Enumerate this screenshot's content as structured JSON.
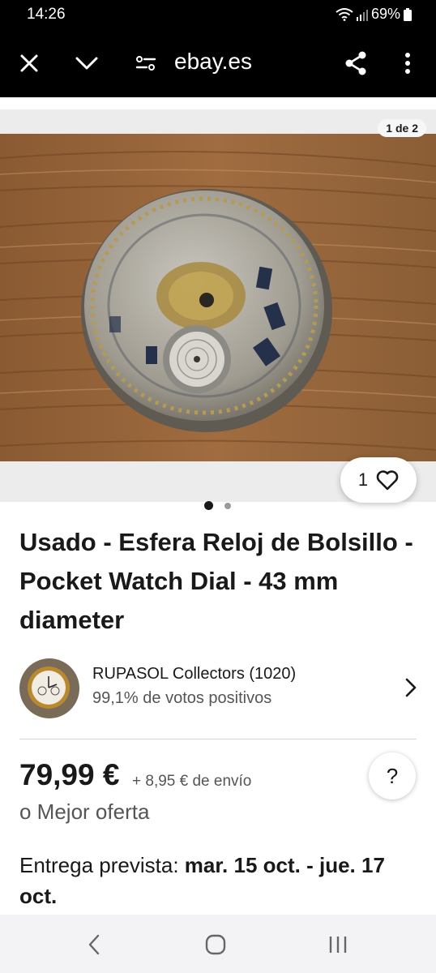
{
  "status_bar": {
    "time": "14:26",
    "battery": "69%",
    "icons": [
      "wifi-icon",
      "signal-icon",
      "battery-icon"
    ]
  },
  "toolbar": {
    "url": "ebay.es",
    "icons": [
      "close-icon",
      "chevron-down-icon",
      "tune-icon",
      "share-icon",
      "more-vert-icon"
    ]
  },
  "gallery": {
    "counter": "1 de 2",
    "watch_count": "1",
    "page_dots": 2,
    "active_dot": 0
  },
  "listing": {
    "title": "Usado - Esfera Reloj de Bolsillo - Pocket Watch Dial - 43 mm diameter",
    "price": "79,99 €",
    "shipping": "+ 8,95 € de envío",
    "best_offer": "o Mejor oferta",
    "delivery_label": "Entrega prevista:",
    "delivery_dates": "mar. 15 oct. - jue. 17 oct."
  },
  "seller": {
    "name": "RUPASOL Collectors (1020)",
    "feedback": "99,1% de votos positivos"
  },
  "help": {
    "label": "?"
  },
  "colors": {
    "bar_bg": "#000000",
    "text_primary": "#191919",
    "text_secondary": "#555555",
    "nav_bg": "#f3f3f6"
  }
}
